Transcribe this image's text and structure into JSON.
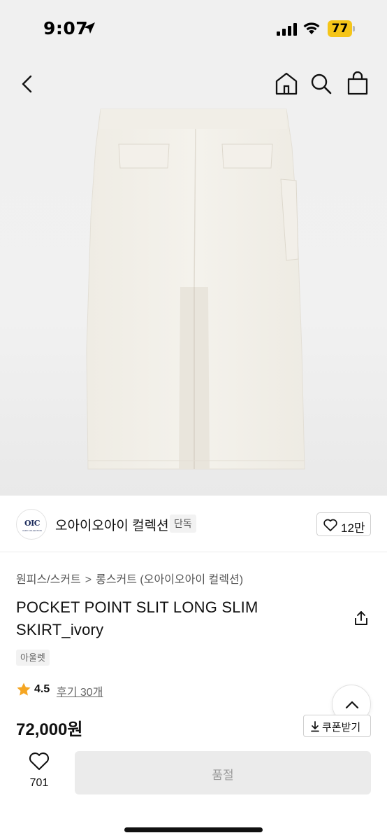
{
  "status_bar": {
    "time": "9:07",
    "battery_level": "77",
    "battery_color": "#f5c518"
  },
  "nav": {
    "icons": [
      "back-icon",
      "home-icon",
      "search-icon",
      "shopping-bag-icon"
    ]
  },
  "brand": {
    "logo_text": "OIC",
    "logo_subtext": "OHIO COLLECTION",
    "name": "오아이오아이 컬렉션",
    "badge": "단독",
    "like_count": "12만"
  },
  "breadcrumb": {
    "items": [
      "원피스/스커트",
      "롱스커트 (오아이오아이 컬렉션)"
    ],
    "separator": ">"
  },
  "product": {
    "title": "POCKET POINT SLIT LONG SLIM SKIRT_ivory",
    "tag": "아울렛",
    "rating": "4.5",
    "review_link": "후기 30개",
    "price": "72,000원",
    "coupon_label": "쿠폰받기"
  },
  "bottom_bar": {
    "wish_count": "701",
    "soldout_label": "품절"
  },
  "colors": {
    "star": "#f5a623",
    "soldout_bg": "#ebebeb",
    "logo": "#1b2a5b"
  }
}
